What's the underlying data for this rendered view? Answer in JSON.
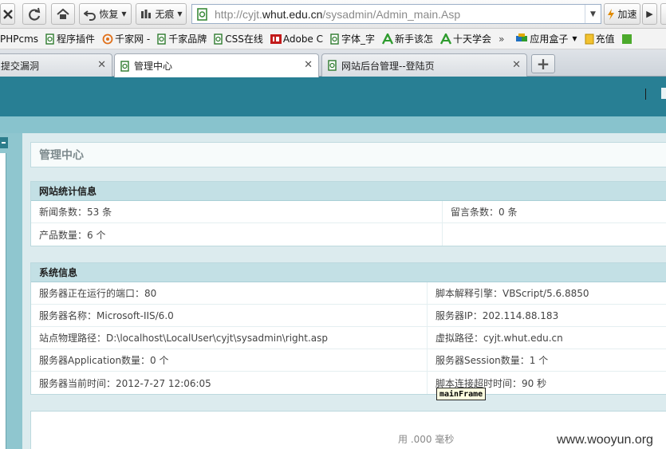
{
  "toolbar": {
    "back_label": "恢复",
    "incognito_label": "无痕",
    "url_plain": "http://cyjt.",
    "url_domain": "whut.edu.cn",
    "url_path": "/sysadmin/Admin_main.Asp",
    "speed_label": "加速"
  },
  "bookmarks": [
    {
      "label": "PHPcms"
    },
    {
      "label": "程序插件"
    },
    {
      "label": "千家网 -"
    },
    {
      "label": "千家品牌"
    },
    {
      "label": "CSS在线"
    },
    {
      "label": "Adobe C"
    },
    {
      "label": "字体_字"
    },
    {
      "label": "新手该怎"
    },
    {
      "label": "十天学会"
    },
    {
      "label": "»"
    },
    {
      "label": "应用盒子"
    },
    {
      "label": "充值"
    }
  ],
  "tabs": [
    {
      "label": "提交漏洞"
    },
    {
      "label": "管理中心"
    },
    {
      "label": "网站后台管理--登陆页"
    }
  ],
  "page": {
    "title": "管理中心",
    "stats": {
      "heading": "网站统计信息",
      "news": "新闻条数：53 条",
      "messages": "留言条数：0 条",
      "products": "产品数量：6 个"
    },
    "system": {
      "heading": "系统信息",
      "rows": [
        [
          "服务器正在运行的端口：80",
          "脚本解释引擎：VBScript/5.6.8850"
        ],
        [
          "服务器名称：Microsoft-IIS/6.0",
          "服务器IP：202.114.88.183"
        ],
        [
          "站点物理路径：D:\\localhost\\LocalUser\\cyjt\\sysadmin\\right.asp",
          "虚拟路径：cyjt.whut.edu.cn"
        ],
        [
          "服务器Application数量：0 个",
          "服务器Session数量：1 个"
        ],
        [
          "服务器当前时间：2012-7-27 12:06:05",
          "脚本连接超时时间：90 秒"
        ]
      ]
    },
    "footer_text": "用 .000 毫秒",
    "tooltip": "mainFrame",
    "watermark": "www.wooyun.org"
  }
}
